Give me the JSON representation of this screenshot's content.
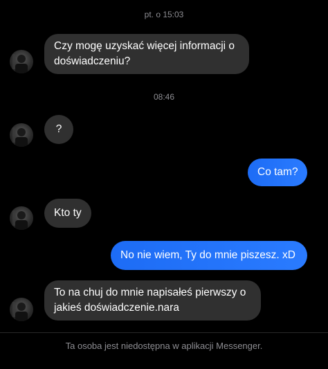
{
  "timestamps": {
    "first": "pt. o 15:03",
    "second": "08:46"
  },
  "messages": [
    {
      "direction": "incoming",
      "text_line1": "Czy mogę uzyskać więcej informacji o",
      "text_line2": "doświadczeniu?"
    },
    {
      "direction": "incoming",
      "text": "?"
    },
    {
      "direction": "outgoing",
      "text": "Co tam?"
    },
    {
      "direction": "incoming",
      "text": "Kto ty"
    },
    {
      "direction": "outgoing",
      "text": "No nie wiem, Ty do mnie piszesz. xD"
    },
    {
      "direction": "incoming",
      "text_line1": "To na chuj do mnie napisałeś pierwszy o",
      "text_line2": "jakieś doświadczenie.nara"
    }
  ],
  "footer": {
    "notice": "Ta osoba jest niedostępna w aplikacji Messenger."
  },
  "colors": {
    "background": "#000000",
    "incoming_bubble": "#303030",
    "outgoing_bubble": "#1d6cf5",
    "secondary_text": "#8e8e93"
  }
}
